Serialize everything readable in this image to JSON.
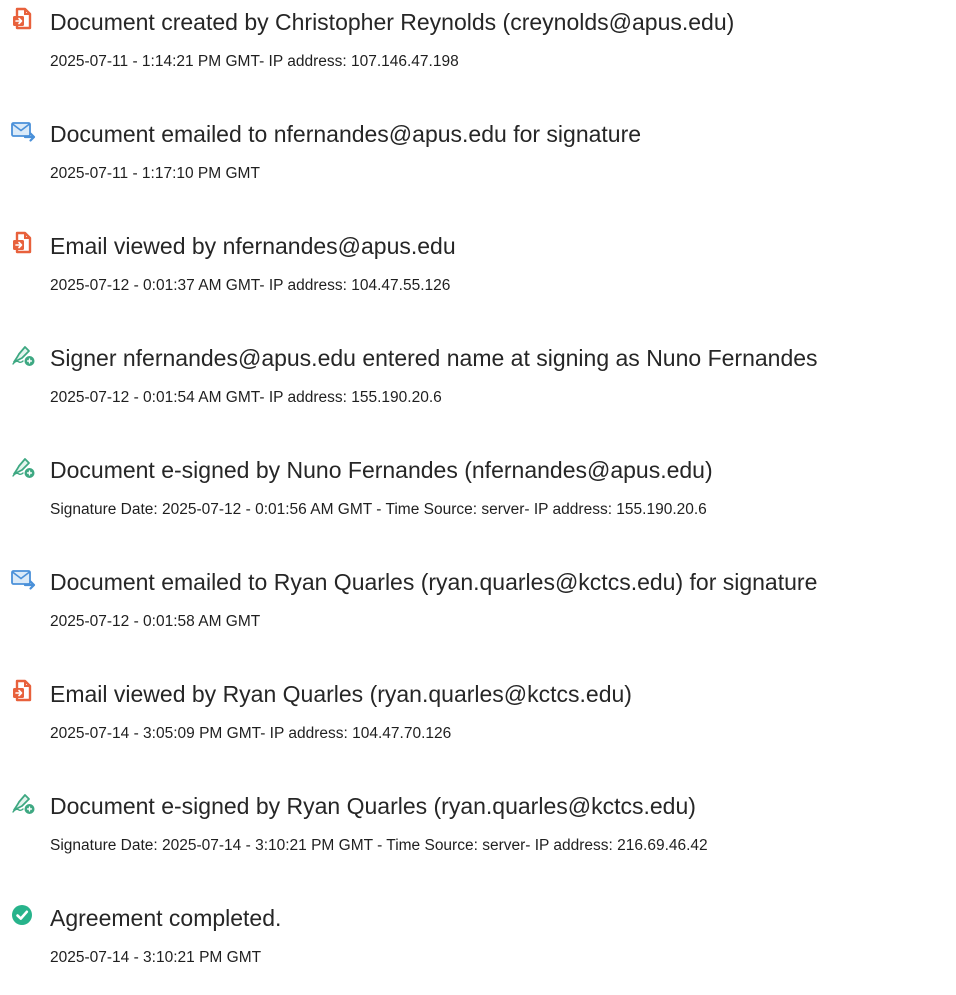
{
  "audit_events": [
    {
      "icon": "document-created-icon",
      "title": "Document created by Christopher Reynolds (creynolds@apus.edu)",
      "detail": "2025-07-11 - 1:14:21 PM GMT- IP address: 107.146.47.198"
    },
    {
      "icon": "email-sent-icon",
      "title": "Document emailed to nfernandes@apus.edu for signature",
      "detail": "2025-07-11 - 1:17:10 PM GMT"
    },
    {
      "icon": "email-viewed-icon",
      "title": "Email viewed by nfernandes@apus.edu",
      "detail": "2025-07-12 - 0:01:37 AM GMT- IP address: 104.47.55.126"
    },
    {
      "icon": "signer-pen-icon",
      "title": "Signer nfernandes@apus.edu entered name at signing as Nuno Fernandes",
      "detail": "2025-07-12 - 0:01:54 AM GMT- IP address: 155.190.20.6"
    },
    {
      "icon": "signer-pen-icon",
      "title": "Document e-signed by Nuno Fernandes (nfernandes@apus.edu)",
      "detail": "Signature Date: 2025-07-12 - 0:01:56 AM GMT - Time Source: server- IP address: 155.190.20.6"
    },
    {
      "icon": "email-sent-icon",
      "title": "Document emailed to Ryan Quarles (ryan.quarles@kctcs.edu) for signature",
      "detail": "2025-07-12 - 0:01:58 AM GMT"
    },
    {
      "icon": "email-viewed-icon",
      "title": "Email viewed by Ryan Quarles (ryan.quarles@kctcs.edu)",
      "detail": "2025-07-14 - 3:05:09 PM GMT- IP address: 104.47.70.126"
    },
    {
      "icon": "signer-pen-icon",
      "title": "Document e-signed by Ryan Quarles (ryan.quarles@kctcs.edu)",
      "detail": "Signature Date: 2025-07-14 - 3:10:21 PM GMT - Time Source: server- IP address: 216.69.46.42"
    },
    {
      "icon": "checkmark-circle-icon",
      "title": "Agreement completed.",
      "detail": "2025-07-14 - 3:10:21 PM GMT"
    }
  ],
  "colors": {
    "document_icon": "#e8613c",
    "email_icon": "#4a90d9",
    "pen_icon": "#3ea882",
    "complete_icon": "#27b38b"
  }
}
